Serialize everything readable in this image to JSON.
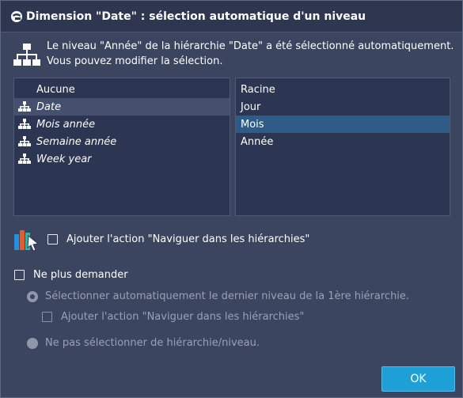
{
  "dialog": {
    "title": "Dimension \"Date\" : sélection automatique d'un niveau",
    "info_line1": "Le niveau \"Année\" de la hiérarchie \"Date\" a été sélectionné automatiquement.",
    "info_line2": "Vous pouvez modifier la sélection."
  },
  "hierarchies": [
    {
      "label": "Aucune",
      "icon": null,
      "italic": false,
      "selected": false
    },
    {
      "label": "Date",
      "icon": "hierarchy-icon",
      "italic": true,
      "selected": true
    },
    {
      "label": "Mois année",
      "icon": "hierarchy-icon",
      "italic": true,
      "selected": false
    },
    {
      "label": "Semaine année",
      "icon": "hierarchy-icon",
      "italic": true,
      "selected": false
    },
    {
      "label": "Week year",
      "icon": "hierarchy-icon",
      "italic": true,
      "selected": false
    }
  ],
  "levels": [
    {
      "label": "Racine",
      "selected": false
    },
    {
      "label": "Jour",
      "selected": false
    },
    {
      "label": "Mois",
      "selected": true
    },
    {
      "label": "Année",
      "selected": false
    }
  ],
  "options": {
    "add_action_label": "Ajouter l'action \"Naviguer dans les hiérarchies\"",
    "add_action_checked": false,
    "dont_ask_label": "Ne plus demander",
    "dont_ask_checked": false,
    "auto_last_level_label": "Sélectionner automatiquement le dernier niveau de la 1ère hiérarchie.",
    "auto_last_level_checked": true,
    "sub_add_action_label": "Ajouter l'action \"Naviguer dans les hiérarchies\"",
    "sub_add_action_checked": false,
    "no_selection_label": "Ne pas sélectionner de hiérarchie/niveau.",
    "no_selection_checked": false
  },
  "buttons": {
    "ok": "OK"
  },
  "colors": {
    "accent": "#1ea0d7",
    "background": "#3b4560",
    "list_bg": "#2c3551",
    "selection_blue": "#2f5b87"
  }
}
